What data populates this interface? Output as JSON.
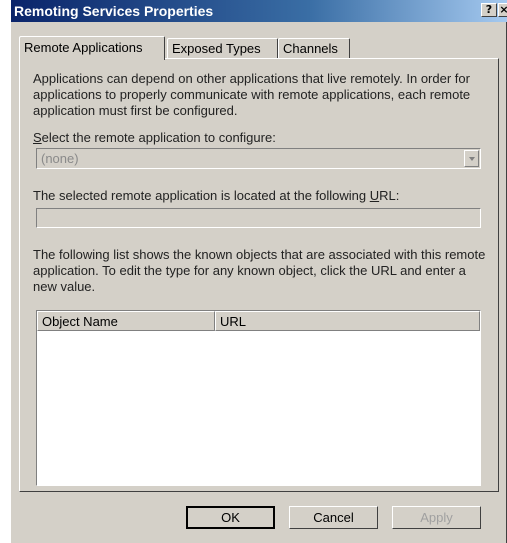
{
  "window": {
    "title": "Remoting Services Properties"
  },
  "title_buttons": {
    "help": "?",
    "close": "×"
  },
  "tabs": [
    {
      "label": "Remote Applications",
      "active": true
    },
    {
      "label": "Exposed Types",
      "active": false
    },
    {
      "label": "Channels",
      "active": false
    }
  ],
  "intro_text": "Applications can depend on other applications that live remotely. In order for applications to properly communicate with remote applications, each remote application must first be configured.",
  "select": {
    "label_prefix": "",
    "label_mnemonic": "S",
    "label_rest": "elect the remote application to configure:",
    "value": "(none)"
  },
  "url": {
    "label_before": "The selected remote application is located at the following ",
    "label_mnemonic": "U",
    "label_after": "RL:",
    "value": ""
  },
  "list_text": "The following list shows the known objects that are associated with this remote application. To edit the type for any known object, click the URL and enter a new value.",
  "list": {
    "columns": [
      "Object Name",
      "URL"
    ],
    "rows": []
  },
  "buttons": {
    "ok": "OK",
    "cancel": "Cancel",
    "apply": "Apply"
  }
}
